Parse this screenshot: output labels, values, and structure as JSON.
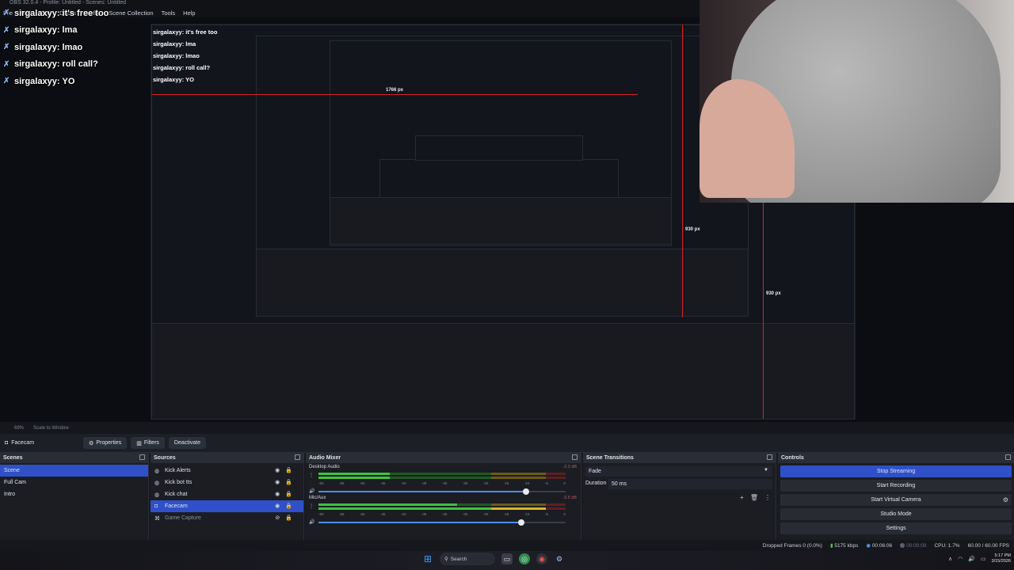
{
  "window": {
    "title": "OBS 32.0.4 - Profile: Untitled - Scenes: Untitled",
    "menu": [
      "File",
      "Edit",
      "View",
      "Docks",
      "Profile",
      "Scene Collection",
      "Tools",
      "Help"
    ]
  },
  "chat": [
    {
      "user": "sirgalaxyy:",
      "text": "it's free too"
    },
    {
      "user": "sirgalaxyy:",
      "text": "lma"
    },
    {
      "user": "sirgalaxyy:",
      "text": "lmao"
    },
    {
      "user": "sirgalaxyy:",
      "text": "roll call?"
    },
    {
      "user": "sirgalaxyy:",
      "text": "YO"
    }
  ],
  "preview": {
    "labels": [
      "1766 px",
      "930 px",
      "930 px"
    ],
    "zoom": "69%",
    "scale_mode": "Scale to Window"
  },
  "source_toolbar": {
    "source_name": "Facecam",
    "properties": "Properties",
    "filters": "Filters",
    "deactivate": "Deactivate"
  },
  "scenes": {
    "title": "Scenes",
    "items": [
      "Scene",
      "Full Cam",
      "Intro"
    ],
    "selected": 0
  },
  "sources": {
    "title": "Sources",
    "items": [
      {
        "name": "Kick Alerts",
        "icon": "browser-icon"
      },
      {
        "name": "Kick bot tts",
        "icon": "browser-icon"
      },
      {
        "name": "Kick chat",
        "icon": "browser-icon"
      },
      {
        "name": "Facecam",
        "icon": "camera-icon",
        "selected": true
      },
      {
        "name": "Game Capture",
        "icon": "gamepad-icon",
        "hidden": true
      }
    ]
  },
  "mixer": {
    "title": "Audio Mixer",
    "ticks": [
      "-60",
      "-55",
      "-50",
      "-45",
      "-40",
      "-35",
      "-30",
      "-25",
      "-20",
      "-15",
      "-10",
      "-5",
      "0"
    ],
    "channels": [
      {
        "name": "Desktop Audio",
        "db": "-3.3 dB",
        "level": 0.29,
        "fader": 0.84
      },
      {
        "name": "Mic/Aux",
        "db": "-3.5 dB",
        "level": 0.56,
        "fader": 0.82
      }
    ]
  },
  "transitions": {
    "title": "Scene Transitions",
    "selected": "Fade",
    "duration_label": "Duration",
    "duration_value": "50 ms"
  },
  "controls": {
    "title": "Controls",
    "buttons": [
      "Stop Streaming",
      "Start Recording",
      "Start Virtual Camera",
      "Studio Mode",
      "Settings"
    ]
  },
  "status": {
    "dropped": "Dropped Frames 0 (0.0%)",
    "bitrate": "5175 kbps",
    "stream_time": "00:06:06",
    "rec_time": "00:00:00",
    "cpu": "CPU: 1.7%",
    "fps": "60.00 / 60.00 FPS"
  },
  "taskbar": {
    "search": "Search",
    "time": "5:17 PM",
    "date": "3/15/2026"
  },
  "colors": {
    "accent": "#2f50c8",
    "meter_green": "#3fc23f",
    "meter_yellow": "#d5b52b",
    "meter_red": "#c83434",
    "guide_red": "#d8232a"
  }
}
